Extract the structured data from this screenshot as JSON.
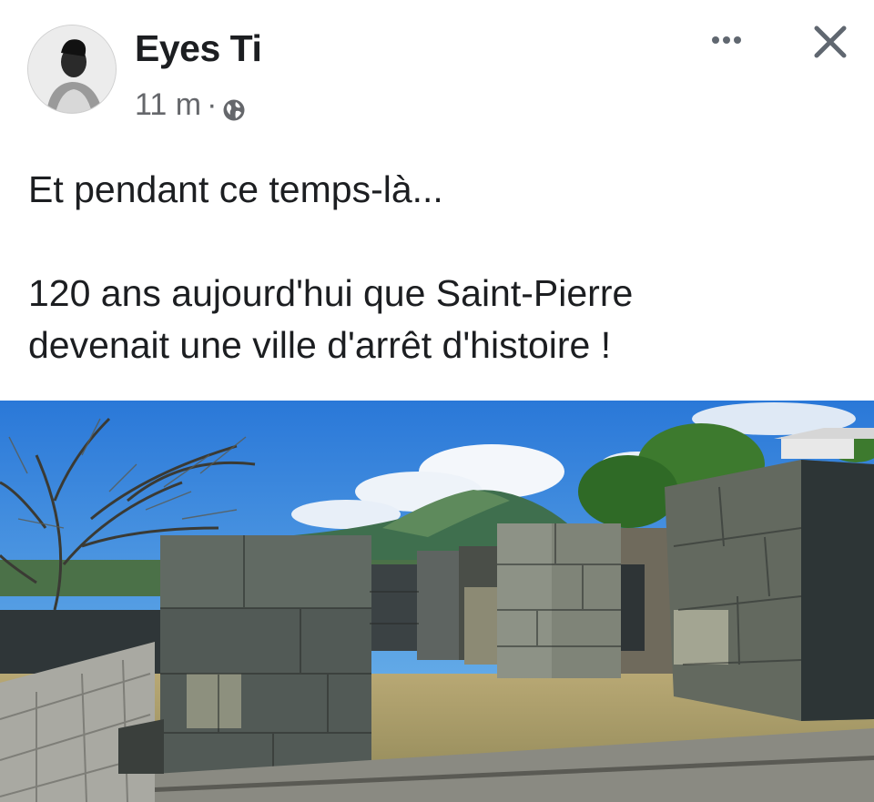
{
  "post": {
    "author": "Eyes Ti",
    "timestamp": "11 m",
    "separator": "·",
    "privacy_icon": "globe-icon",
    "more_icon": "more-options-icon",
    "close_icon": "close-icon",
    "text_line_1": "Et pendant ce temps-là...",
    "text_line_2": "120 ans aujourd'hui que Saint-Pierre",
    "text_line_3": "devenait une ville d'arrêt d'histoire !"
  },
  "colors": {
    "text_primary": "#1c1e21",
    "text_secondary": "#65676b",
    "background": "#ffffff"
  }
}
